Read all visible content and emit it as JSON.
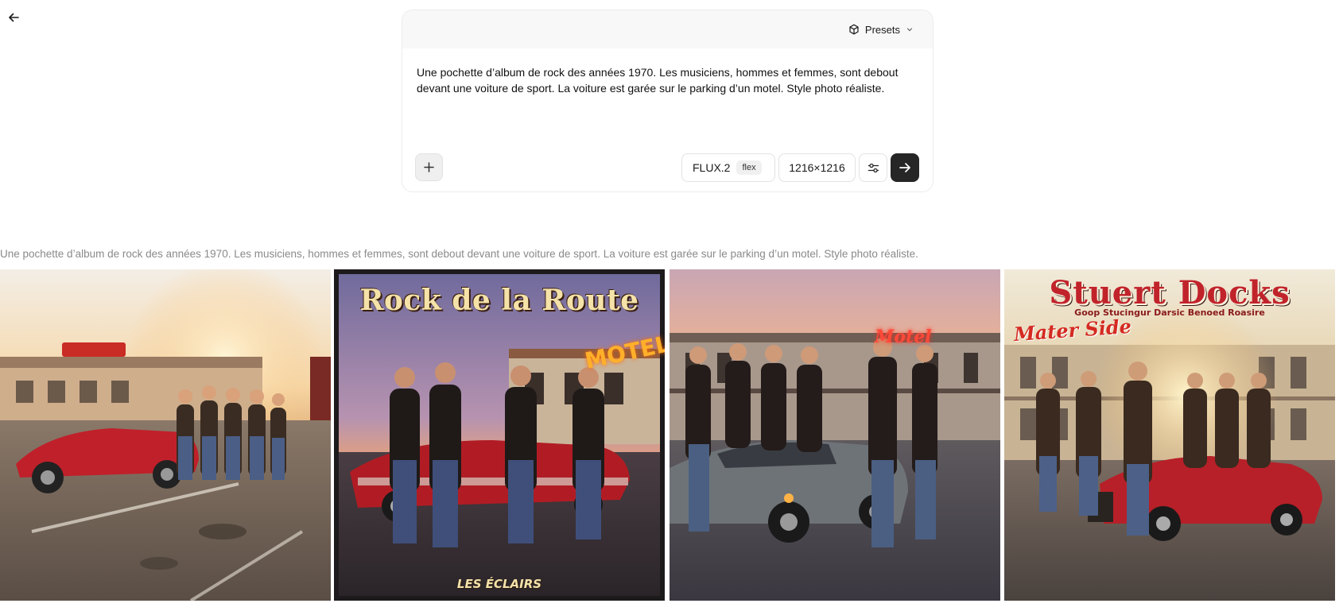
{
  "nav": {
    "back_icon": "arrow-left-icon"
  },
  "composer": {
    "presets_label": "Presets",
    "presets_icon": "cube-icon",
    "presets_chevron": "chevron-down-icon",
    "prompt": "Une pochette d’album de rock des années 1970. Les musiciens, hommes et femmes, sont debout devant une voiture de sport. La voiture est garée sur le parking d’un motel. Style photo réaliste.",
    "add_icon": "plus-icon",
    "model_name": "FLUX.2",
    "model_tag": "flex",
    "size_label": "1216×1216",
    "settings_icon": "sliders-icon",
    "submit_icon": "arrow-right-icon"
  },
  "results": {
    "caption": "Une pochette d’album de rock des années 1970. Les musiciens, hommes et femmes, sont debout devant une voiture de sport. La voiture est garée sur le parking d’un motel. Style photo réaliste.",
    "images": [
      {
        "sign": "",
        "title": "",
        "subtitle": ""
      },
      {
        "sign": "MOTEL",
        "title": "Rock de la Route",
        "subtitle": "LES ÉCLAIRS"
      },
      {
        "sign": "Motel",
        "title": "",
        "subtitle": ""
      },
      {
        "sign": "Mater Side",
        "title": "Stuert Docks",
        "subtitle": "Goop Stucingur Darsic Benoed Roasire"
      }
    ]
  },
  "colors": {
    "accent_dark": "#262626",
    "car_red": "#c0202a",
    "car_silver": "#6e7378",
    "neon_red": "#e8362b"
  }
}
